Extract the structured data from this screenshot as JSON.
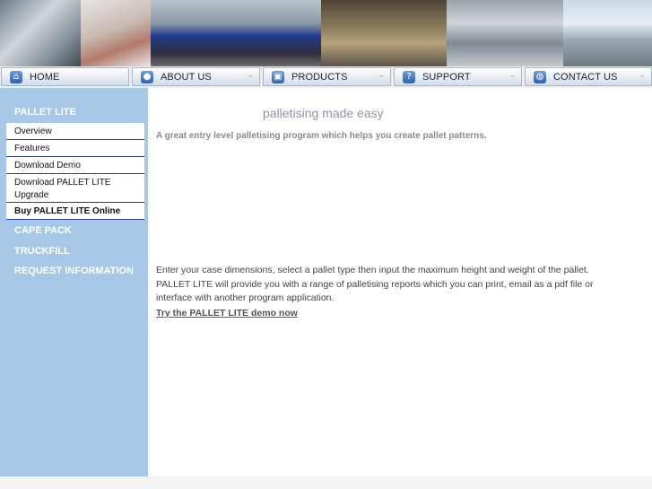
{
  "banner": {
    "photos": [
      "office-photo",
      "hands-photo",
      "truck-photo",
      "warehouse-photo",
      "shelves-photo",
      "building-photo"
    ]
  },
  "nav": {
    "items": [
      {
        "label": "HOME",
        "icon": "home-icon",
        "glyph": "⌂"
      },
      {
        "label": "ABOUT US",
        "icon": "user-icon",
        "glyph": "●"
      },
      {
        "label": "PRODUCTS",
        "icon": "box-icon",
        "glyph": "▣"
      },
      {
        "label": "SUPPORT",
        "icon": "question-icon",
        "glyph": "?"
      },
      {
        "label": "CONTACT US",
        "icon": "globe-icon",
        "glyph": "◍"
      }
    ],
    "chevron": "⌄"
  },
  "sidebar": {
    "section_title": "PALLET LITE",
    "items": [
      "Overview",
      "Features",
      "Download Demo",
      "Download PALLET LITE Upgrade",
      "Buy PALLET LITE Online"
    ],
    "links": [
      "CAPE PACK",
      "TRUCKFILL",
      "REQUEST INFORMATION"
    ]
  },
  "main": {
    "tagline": "palletising made easy",
    "intro": "A great entry level palletising program which helps you create pallet patterns.",
    "body": "Enter your case dimensions, select a pallet type then input the maximum height and weight of the pallet. PALLET LITE will provide you with a range of palletising reports which you can print, email as a pdf file or interface with another program application.",
    "demo_link": "Try the PALLET LITE demo now"
  }
}
